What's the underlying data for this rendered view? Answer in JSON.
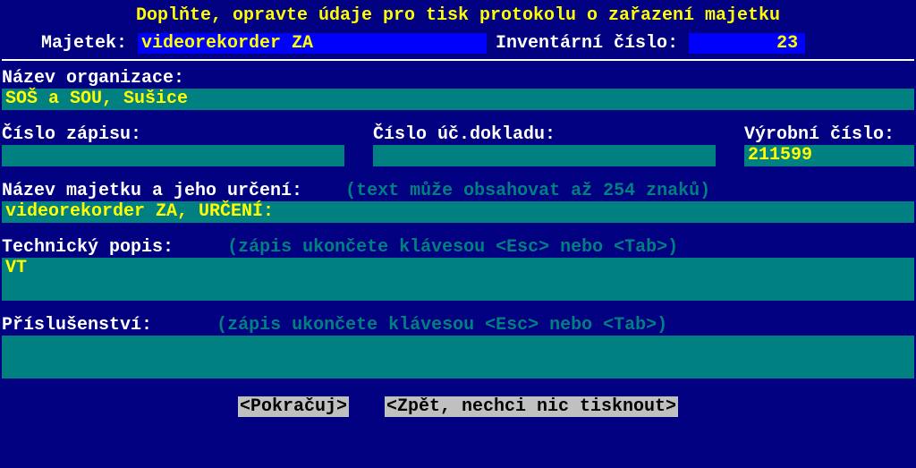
{
  "title": "Doplňte, opravte údaje pro tisk protokolu o zařazení majetku",
  "header": {
    "majetek_label": "Majetek:",
    "majetek_value": "videorekorder   ZA",
    "inv_label": "Inventární číslo:",
    "inv_value": "23"
  },
  "org": {
    "label": "Název organizace:",
    "value": "SOŠ a SOU, Sušice"
  },
  "zapis": {
    "label": "Číslo zápisu:",
    "value": ""
  },
  "doklad": {
    "label": "Číslo úč.dokladu:",
    "value": ""
  },
  "vyrobni": {
    "label": "Výrobní číslo:",
    "value": "211599"
  },
  "nazev_majetku": {
    "label": "Název majetku a jeho určení:",
    "hint": "(text může obsahovat až 254 znaků)",
    "value": "videorekorder   ZA, URČENÍ:"
  },
  "technicky_popis": {
    "label": "Technický popis:",
    "hint": "(zápis ukončete klávesou <Esc> nebo <Tab>)",
    "value": "VT"
  },
  "prislusenstvi": {
    "label": "Příslušenství:",
    "hint": "(zápis ukončete klávesou <Esc> nebo <Tab>)",
    "value": ""
  },
  "buttons": {
    "continue": "<Pokračuj>",
    "back": "<Zpět, nechci nic tisknout>"
  }
}
